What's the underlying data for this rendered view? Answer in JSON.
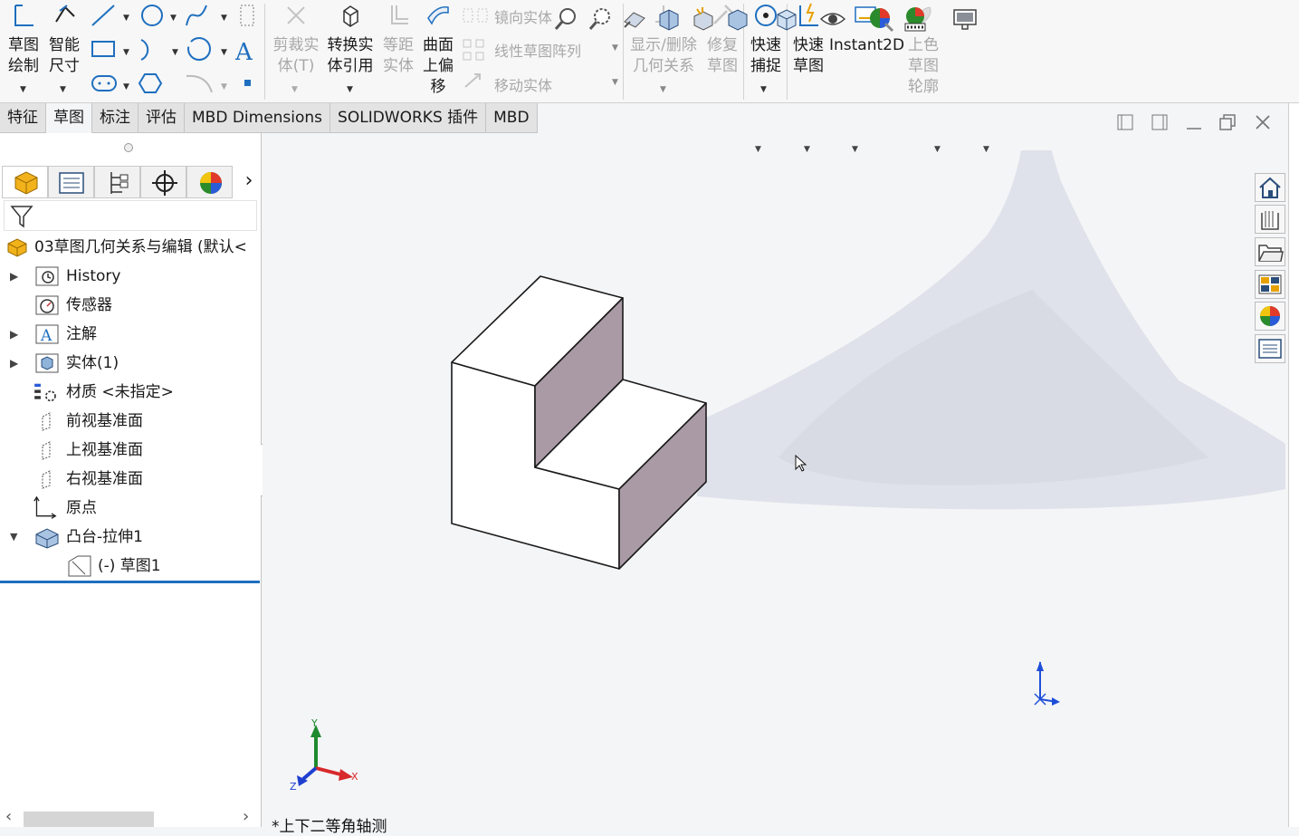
{
  "ribbon": {
    "sketch_draw": "草图\n绘制",
    "smart_dim": "智能\n尺寸",
    "trim": "剪裁实\n体(T)",
    "convert": "转换实\n体引用",
    "offset": "等距\n实体",
    "surface_offset": "曲面\n上偏\n移",
    "mirror": "镜向实体",
    "linear_pattern": "线性草图阵列",
    "move": "移动实体",
    "show_relations": "显示/删除\n几何关系",
    "repair": "修复\n草图",
    "quick_snap": "快速\n捕捉",
    "rapid_sketch": "快速\n草图",
    "instant2d": "Instant2D",
    "shaded_contour": "上色\n草图\n轮廓"
  },
  "tabs": [
    "特征",
    "草图",
    "标注",
    "评估",
    "MBD Dimensions",
    "SOLIDWORKS 插件",
    "MBD"
  ],
  "active_tab": "草图",
  "tree": {
    "root": "03草图几何关系与编辑 (默认<",
    "items": [
      {
        "label": "History",
        "icon": "history-icon"
      },
      {
        "label": "传感器",
        "icon": "sensor-icon"
      },
      {
        "label": "注解",
        "icon": "annotation-icon"
      },
      {
        "label": "实体(1)",
        "icon": "solid-body-icon"
      },
      {
        "label": "材质 <未指定>",
        "icon": "material-icon"
      },
      {
        "label": "前视基准面",
        "icon": "plane-icon"
      },
      {
        "label": "上视基准面",
        "icon": "plane-icon"
      },
      {
        "label": "右视基准面",
        "icon": "plane-icon"
      },
      {
        "label": "原点",
        "icon": "origin-icon"
      },
      {
        "label": "凸台-拉伸1",
        "icon": "extrude-icon"
      },
      {
        "label": "(-) 草图1",
        "icon": "sketch-icon"
      }
    ]
  },
  "triad": {
    "x": "X",
    "y": "Y",
    "z": "Z"
  },
  "status": "*上下二等角轴测",
  "colors": {
    "accent_blue": "#1f6fbf",
    "face_shade": "#a99aa6",
    "glow": "#dfe2ea"
  }
}
